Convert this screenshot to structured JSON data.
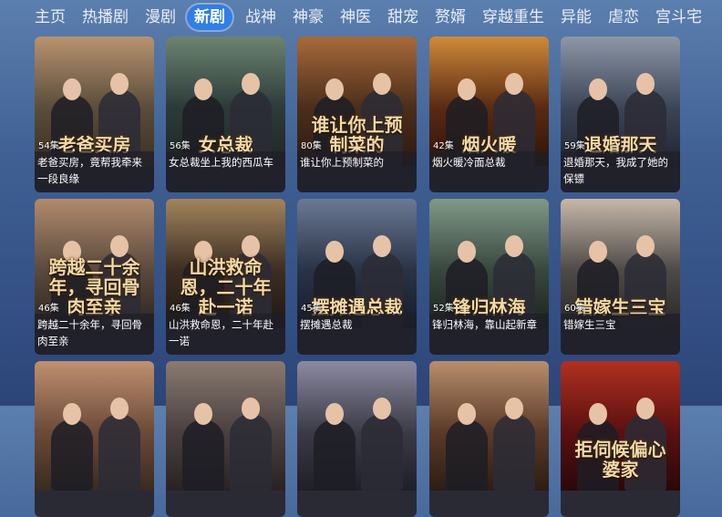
{
  "nav": {
    "items": [
      "主页",
      "热播剧",
      "漫剧",
      "新剧",
      "战神",
      "神豪",
      "神医",
      "甜宠",
      "赘婿",
      "穿越重生",
      "异能",
      "虐恋",
      "宫斗宅"
    ],
    "active_index": 3
  },
  "cards": [
    {
      "episodes": "54集",
      "title": "老爸买房，竟帮我牵来一段良缘",
      "art_text": "老爸买房",
      "colors": [
        "#5a4d3a",
        "#b99370",
        "#3c2f24"
      ]
    },
    {
      "episodes": "56集",
      "title": "女总裁坐上我的西瓜车",
      "art_text": "女总裁",
      "colors": [
        "#2c3b3a",
        "#6c8470",
        "#1d2723"
      ]
    },
    {
      "episodes": "80集",
      "title": "谁让你上预制菜的",
      "art_text": "谁让你上预制菜的",
      "colors": [
        "#4b2e1b",
        "#a86a3a",
        "#2b1a10"
      ]
    },
    {
      "episodes": "42集",
      "title": "烟火暖冷面总裁",
      "art_text": "烟火暖",
      "colors": [
        "#5a2a12",
        "#d08a3a",
        "#2c1409"
      ]
    },
    {
      "episodes": "59集",
      "title": "退婚那天，我成了她的保镖",
      "art_text": "退婚那天",
      "colors": [
        "#3c4556",
        "#8e97a6",
        "#1f2430"
      ]
    },
    {
      "episodes": "46集",
      "title": "跨越二十余年，寻回骨肉至亲",
      "art_text": "跨越二十余年，寻回骨肉至亲",
      "colors": [
        "#5b4a3e",
        "#b08a6c",
        "#2c231d"
      ]
    },
    {
      "episodes": "46集",
      "title": "山洪救命恩，二十年赴一诺",
      "art_text": "山洪救命恩，二十年赴一诺",
      "colors": [
        "#3d2e22",
        "#a3845e",
        "#1f1712"
      ]
    },
    {
      "episodes": "45集",
      "title": "摆摊遇总裁",
      "art_text": "摆摊遇总裁",
      "colors": [
        "#2a3346",
        "#6a7994",
        "#151b27"
      ]
    },
    {
      "episodes": "52集",
      "title": "锋归林海，靠山起新章",
      "art_text": "锋归林海",
      "colors": [
        "#39473f",
        "#7f9a87",
        "#1b231e"
      ]
    },
    {
      "episodes": "60集",
      "title": "错嫁生三宝",
      "art_text": "错嫁生三宝",
      "colors": [
        "#4e4a48",
        "#c6b8a8",
        "#2a2726"
      ]
    },
    {
      "episodes": "",
      "title": "",
      "art_text": "",
      "colors": [
        "#6b4a38",
        "#c09070",
        "#3a2a20"
      ]
    },
    {
      "episodes": "",
      "title": "",
      "art_text": "",
      "colors": [
        "#4a4040",
        "#8a7a70",
        "#2a2222"
      ]
    },
    {
      "episodes": "",
      "title": "",
      "art_text": "",
      "colors": [
        "#3b3a46",
        "#8b8aa0",
        "#1f1f28"
      ]
    },
    {
      "episodes": "",
      "title": "",
      "art_text": "",
      "colors": [
        "#5a3a28",
        "#b98e6c",
        "#2c1d14"
      ]
    },
    {
      "episodes": "",
      "title": "",
      "art_text": "拒伺候偏心婆家",
      "colors": [
        "#5a1010",
        "#b03020",
        "#2a0808"
      ]
    }
  ]
}
